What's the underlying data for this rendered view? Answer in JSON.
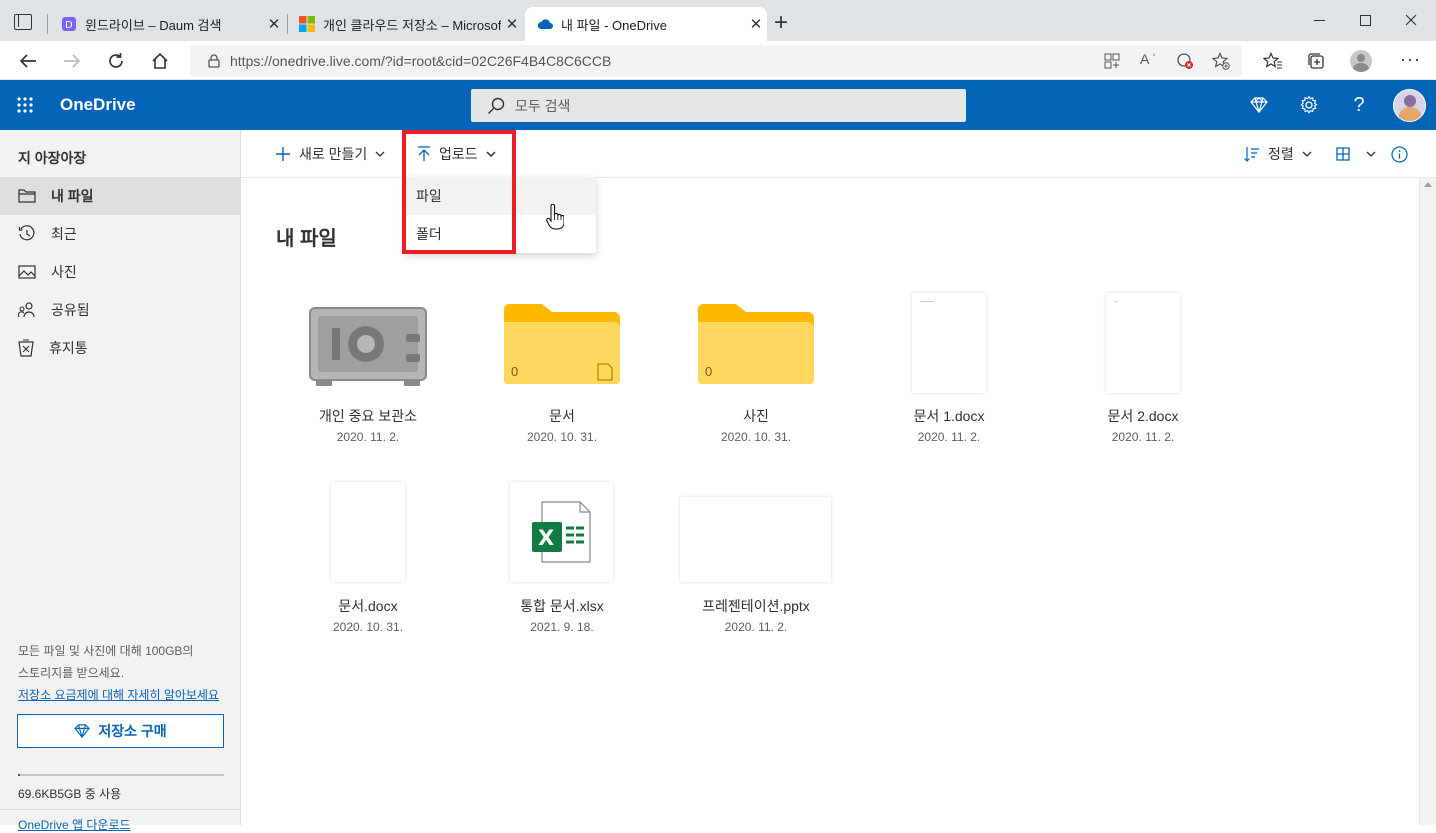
{
  "browser": {
    "tabs": [
      {
        "title": "윈드라이브 – Daum 검색",
        "close": "✕",
        "favicon": "daum-icon"
      },
      {
        "title": "개인 클라우드 저장소 – Microsoft",
        "close": "✕",
        "favicon": "microsoft-icon"
      },
      {
        "title": "내 파일 - OneDrive",
        "close": "✕",
        "favicon": "onedrive-icon"
      }
    ],
    "new_tab": "+",
    "url": "https://onedrive.live.com/?id=root&cid=02C26F4B4C8C6CCB"
  },
  "header": {
    "brand": "OneDrive",
    "search_placeholder": "모두 검색"
  },
  "sidebar": {
    "user": "지 아장아장",
    "items": [
      {
        "label": "내 파일",
        "icon": "folder-icon",
        "selected": true
      },
      {
        "label": "최근",
        "icon": "clock-icon",
        "selected": false
      },
      {
        "label": "사진",
        "icon": "photo-icon",
        "selected": false
      },
      {
        "label": "공유됨",
        "icon": "people-icon",
        "selected": false
      },
      {
        "label": "휴지통",
        "icon": "trash-icon",
        "selected": false
      }
    ],
    "promo_line1": "모든 파일 및 사진에 대해 100GB의",
    "promo_line2": "스토리지를 받으세요.",
    "promo_link": "저장소 요금제에 대해 자세히 알아보세요",
    "buy_label": "저장소 구매",
    "usage_fraction": 1e-05,
    "usage_text": "69.6KB5GB 중 사용",
    "app_link": "OneDrive 앱 다운로드"
  },
  "commands": {
    "new_label": "새로 만들기",
    "upload_label": "업로드",
    "sort_label": "정렬"
  },
  "upload_menu": {
    "options": [
      "파일",
      "폴더"
    ]
  },
  "main": {
    "title": "내 파일",
    "files": [
      {
        "name": "개인 중요 보관소",
        "date": "2020. 11. 2.",
        "kind": "vault"
      },
      {
        "name": "문서",
        "date": "2020. 10. 31.",
        "kind": "folder",
        "count": "0"
      },
      {
        "name": "사진",
        "date": "2020. 10. 31.",
        "kind": "folder",
        "count": "0"
      },
      {
        "name": "문서 1.docx",
        "date": "2020. 11. 2.",
        "kind": "doc"
      },
      {
        "name": "문서 2.docx",
        "date": "2020. 11. 2.",
        "kind": "doc"
      },
      {
        "name": "문서.docx",
        "date": "2020. 10. 31.",
        "kind": "doc"
      },
      {
        "name": "통합 문서.xlsx",
        "date": "2021. 9. 18.",
        "kind": "xlsx"
      },
      {
        "name": "프레젠테이션.pptx",
        "date": "2020. 11. 2.",
        "kind": "pptx"
      }
    ]
  },
  "colors": {
    "accent": "#0364b8",
    "highlight_box": "#ee1c25",
    "folder": "#ffd75e",
    "excel": "#107c41"
  }
}
